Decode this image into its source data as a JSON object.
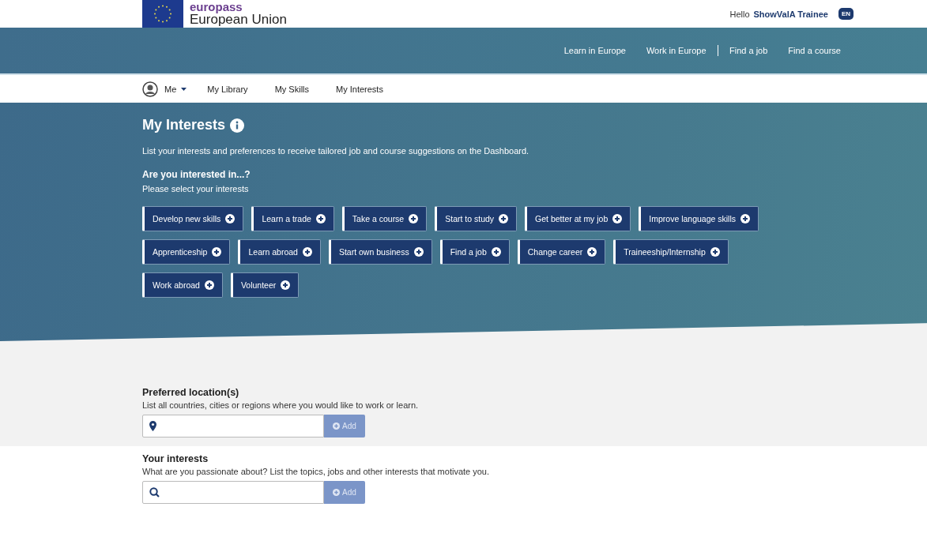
{
  "header": {
    "brand": "europass",
    "subtitle": "European Union",
    "greeting": "Hello",
    "user": "ShowValA Trainee",
    "language": "EN"
  },
  "top_nav": [
    {
      "label": "Learn in Europe"
    },
    {
      "label": "Work in Europe"
    },
    {
      "label": "Find a job"
    },
    {
      "label": "Find a course"
    }
  ],
  "sub_nav": {
    "me": "Me",
    "items": [
      {
        "label": "My Library"
      },
      {
        "label": "My Skills"
      },
      {
        "label": "My Interests"
      }
    ]
  },
  "hero": {
    "title": "My Interests",
    "description": "List your interests and preferences to receive tailored job and course suggestions on the Dashboard.",
    "question": "Are you interested in...?",
    "hint": "Please select your interests",
    "chips": [
      {
        "label": "Develop new skills"
      },
      {
        "label": "Learn a trade"
      },
      {
        "label": "Take a course"
      },
      {
        "label": "Start to study"
      },
      {
        "label": "Get better at my job"
      },
      {
        "label": "Improve language skills"
      },
      {
        "label": "Apprenticeship"
      },
      {
        "label": "Learn abroad"
      },
      {
        "label": "Start own business"
      },
      {
        "label": "Find a job"
      },
      {
        "label": "Change career"
      },
      {
        "label": "Traineeship/Internship"
      },
      {
        "label": "Work abroad"
      },
      {
        "label": "Volunteer"
      }
    ]
  },
  "sections": [
    {
      "kind": "location",
      "title": "Preferred location(s)",
      "description": "List all countries, cities or regions where you would like to work or learn.",
      "button": "Add",
      "disabled": true
    },
    {
      "kind": "search",
      "title": "Your interests",
      "description": "What are you passionate about? List the topics, jobs and other interests that motivate you.",
      "button": "Add",
      "disabled": true
    }
  ]
}
